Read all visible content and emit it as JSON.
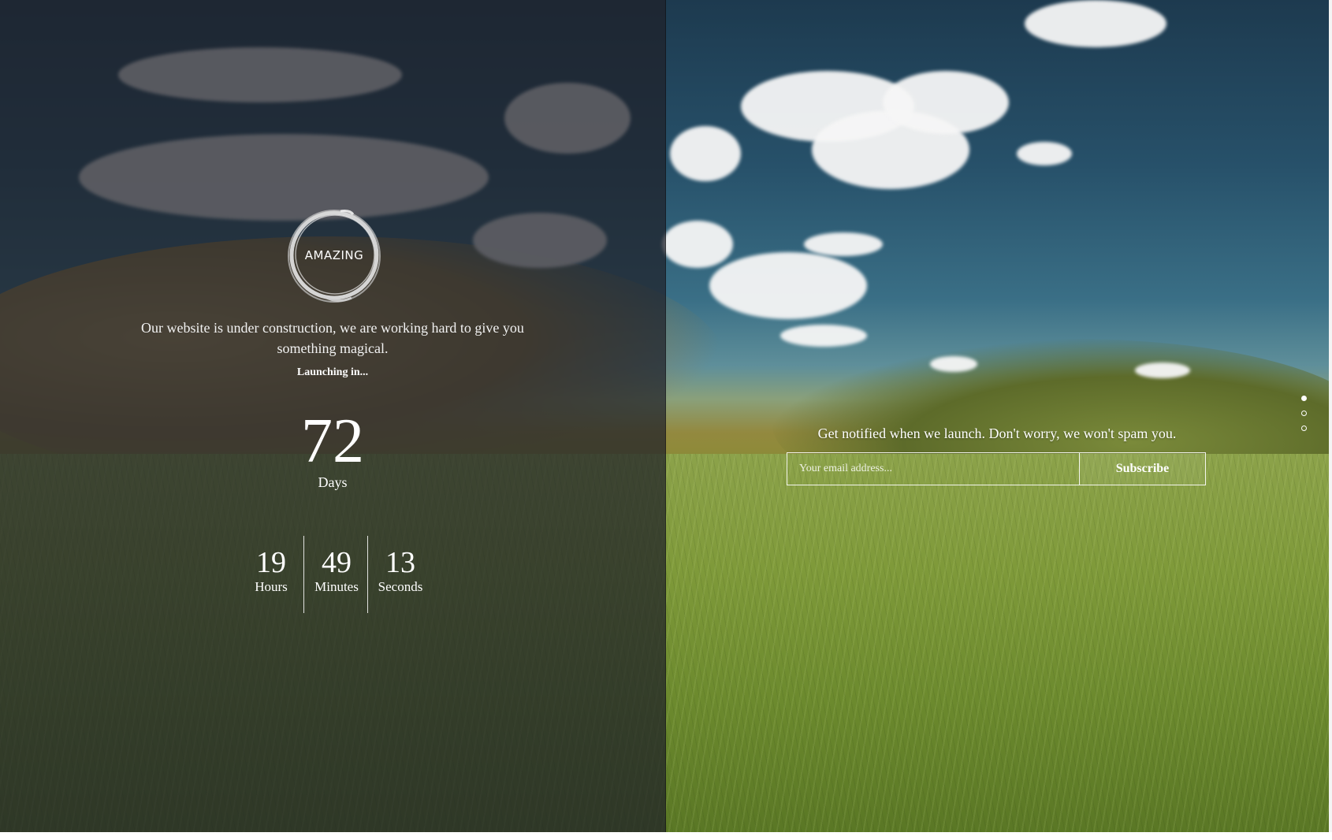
{
  "logo": {
    "text": "AMAZING",
    "icon": "brush-circle-icon"
  },
  "left": {
    "message": "Our website is under construction, we are working hard to give you something magical.",
    "launching": "Launching in...",
    "countdown": {
      "days": {
        "value": "72",
        "label": "Days"
      },
      "hours": {
        "value": "19",
        "label": "Hours"
      },
      "minutes": {
        "value": "49",
        "label": "Minutes"
      },
      "seconds": {
        "value": "13",
        "label": "Seconds"
      }
    }
  },
  "right": {
    "notify": "Get notified when we launch. Don't worry, we won't spam you.",
    "email_placeholder": "Your email address...",
    "subscribe_label": "Subscribe"
  },
  "pagination": {
    "count": 3,
    "active_index": 0
  },
  "colors": {
    "overlay": "#1e2028",
    "text": "#ffffff"
  }
}
